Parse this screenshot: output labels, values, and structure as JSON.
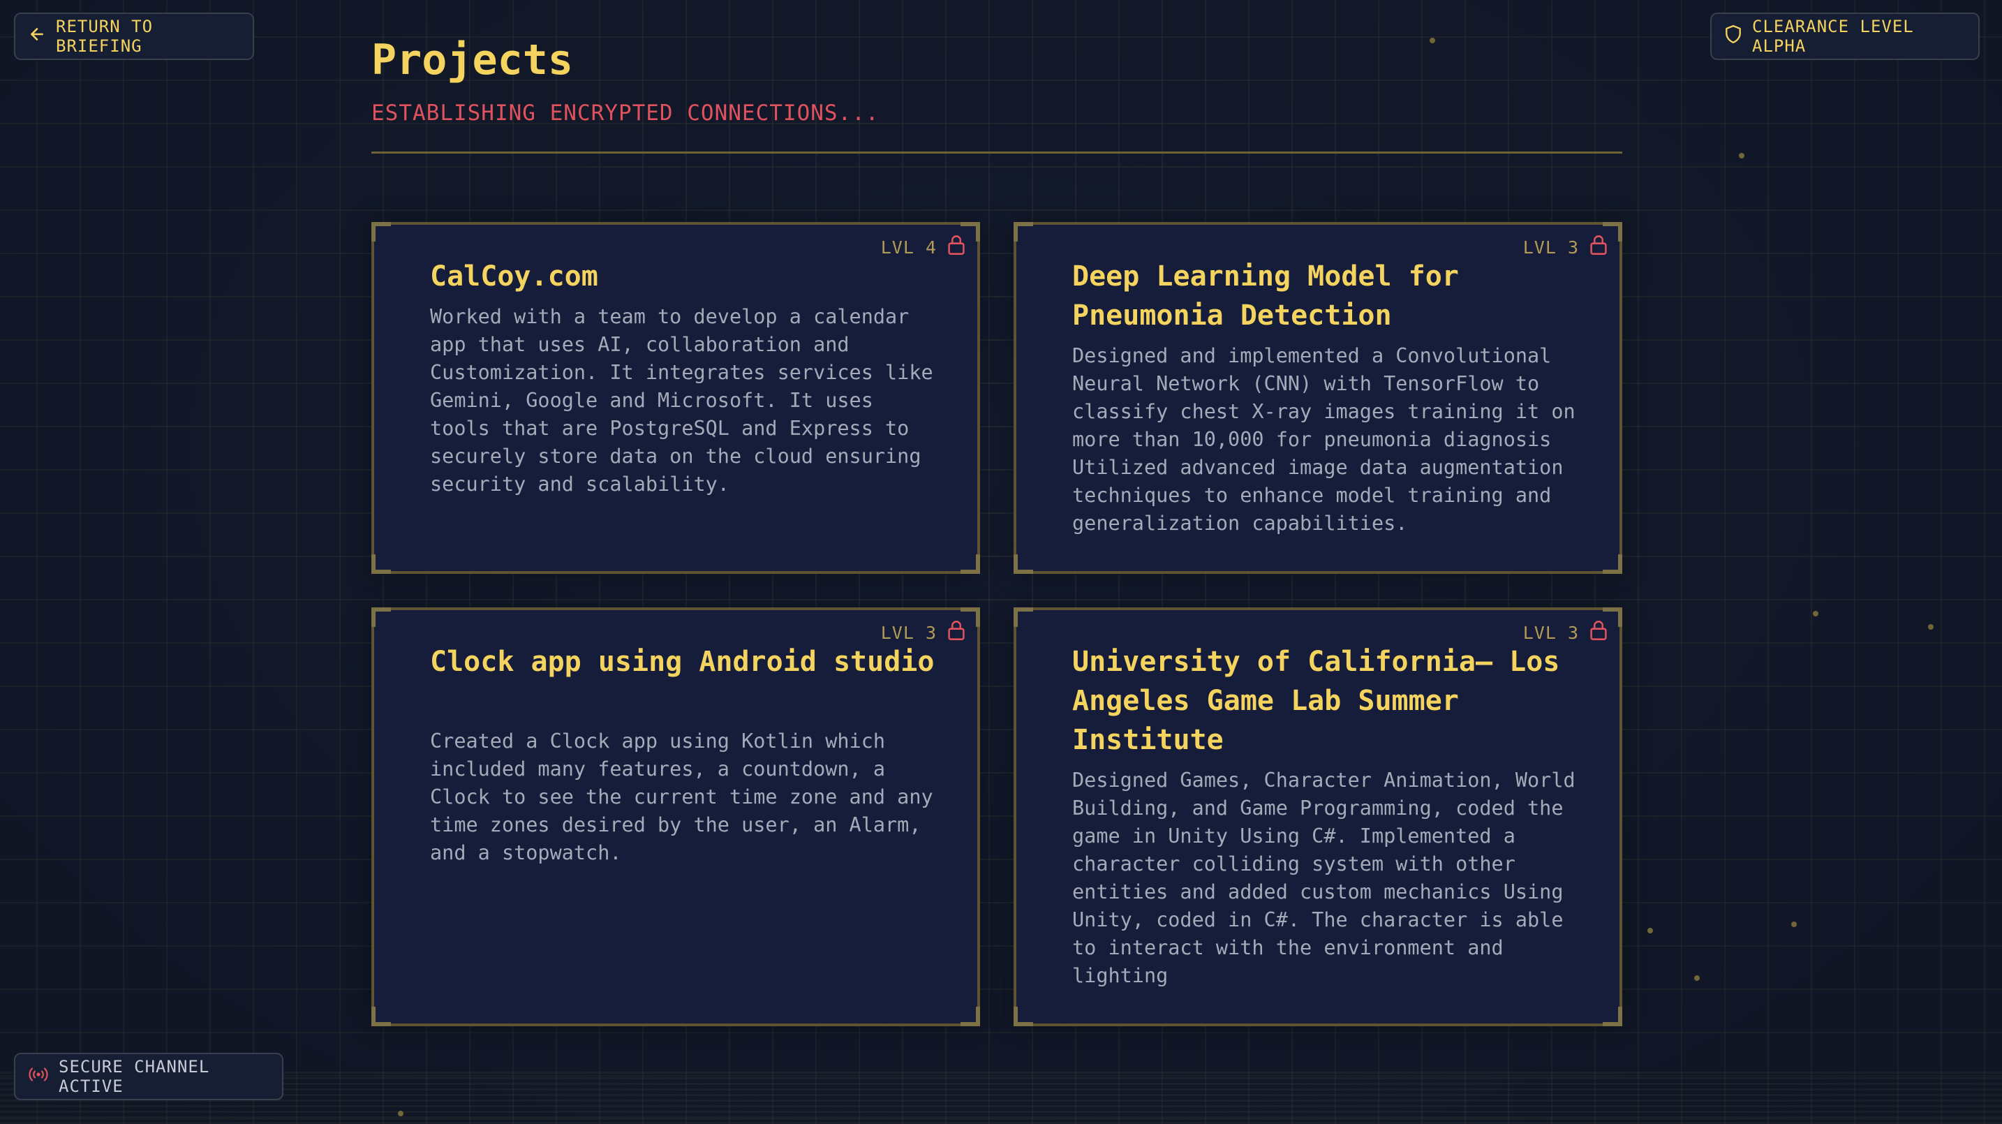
{
  "nav": {
    "return_label": "RETURN TO BRIEFING"
  },
  "clearance": {
    "label": "CLEARANCE LEVEL ALPHA"
  },
  "status": {
    "label": "SECURE CHANNEL ACTIVE"
  },
  "page": {
    "title": "Projects",
    "subtitle": "ESTABLISHING ENCRYPTED CONNECTIONS..."
  },
  "projects": [
    {
      "level": "LVL 4",
      "title": "CalCoy.com",
      "description": "Worked with a team to develop a calendar app that uses AI, collaboration and Customization. It integrates services like Gemini, Google and Microsoft. It uses tools that are PostgreSQL and Express to securely store data on the cloud ensuring security and scalability."
    },
    {
      "level": "LVL 3",
      "title": "Deep Learning Model for Pneumonia Detection",
      "description": "Designed and implemented a Convolutional Neural Network (CNN) with TensorFlow to classify chest X-ray images training it on more than 10,000 for pneumonia diagnosis Utilized advanced image data augmentation techniques to enhance model training and generalization capabilities."
    },
    {
      "level": "LVL 3",
      "title": "Clock app using Android studio",
      "description": "Created a Clock app using Kotlin which included many features, a countdown, a Clock to see the current time zone and any time zones desired by the user, an Alarm, and a stopwatch."
    },
    {
      "level": "LVL 3",
      "title": "University of California– Los Angeles Game Lab Summer Institute",
      "description": "Designed Games, Character Animation, World Building, and Game Programming, coded the game in Unity Using C#. Implemented a character colliding system with other entities and added custom mechanics Using Unity, coded in C#. The character is able to interact with the environment and lighting"
    }
  ],
  "icons": {
    "return": "arrow-left-icon",
    "clearance": "shield-icon",
    "status": "broadcast-icon",
    "level": "lock-icon"
  },
  "colors": {
    "accent_yellow": "#f4d35e",
    "accent_red": "#e0535e",
    "background": "#131a2b",
    "card_background": "#151d3a",
    "card_border": "#5d5432"
  }
}
